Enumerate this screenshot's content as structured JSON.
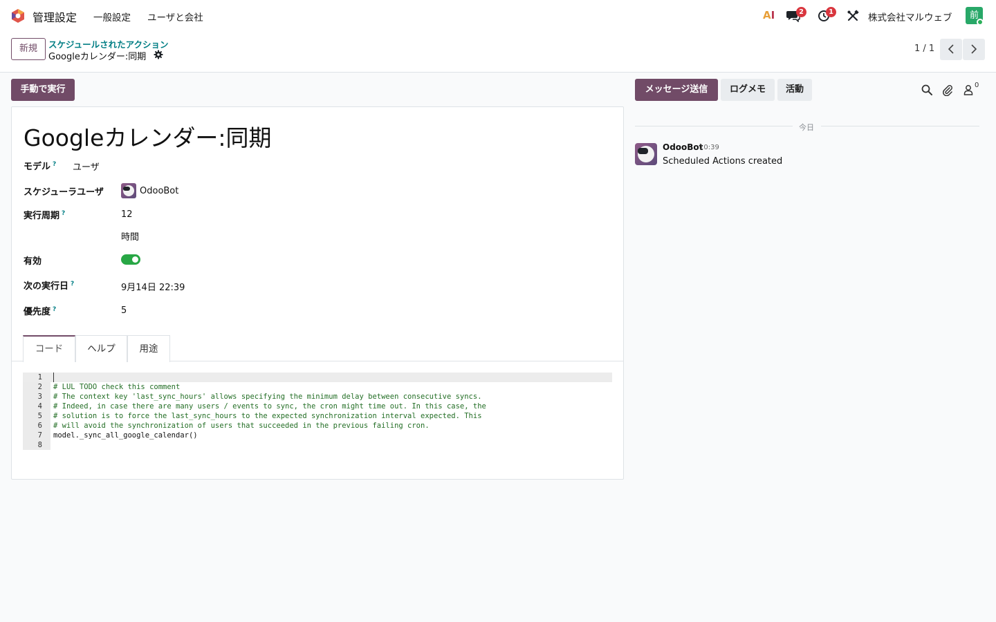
{
  "navbar": {
    "app_name": "管理設定",
    "menu": [
      "一般設定",
      "ユーザと会社"
    ],
    "ai_label_a": "A",
    "ai_label_i": "I",
    "messages_badge": "2",
    "activities_badge": "1",
    "company": "株式会社マルウェブ",
    "user_initial": "前"
  },
  "control": {
    "new_button": "新規",
    "breadcrumb_parent": "スケジュールされたアクション",
    "breadcrumb_current": "Googleカレンダー:同期",
    "pager": "1 / 1"
  },
  "actions": {
    "run_manually": "手動で実行",
    "send_message": "メッセージ送信",
    "log_note": "ログメモ",
    "activities": "活動",
    "followers_count": "0"
  },
  "form": {
    "title": "Googleカレンダー:同期",
    "model_label": "モデル",
    "model_value": "ユーザ",
    "scheduler_user_label": "スケジューラユーザ",
    "scheduler_user_value": "OdooBot",
    "interval_label": "実行周期",
    "interval_number": "12",
    "interval_unit": "時間",
    "active_label": "有効",
    "active": true,
    "nextcall_label": "次の実行日",
    "nextcall_value": "9月14日 22:39",
    "priority_label": "優先度",
    "priority_value": "5",
    "help_mark": "?"
  },
  "tabs": [
    "コード",
    "ヘルプ",
    "用途"
  ],
  "code_lines": [
    "",
    "# LUL TODO check this comment",
    "# The context key 'last_sync_hours' allows specifying the minimum delay between consecutive syncs.",
    "# Indeed, in case there are many users / events to sync, the cron might time out. In this case, the",
    "# solution is to force the last_sync_hours to the expected synchronization interval expected. This",
    "# will avoid the synchronization of users that succeeded in the previous failing cron.",
    "model._sync_all_google_calendar()",
    ""
  ],
  "line_numbers": [
    "1",
    "2",
    "3",
    "4",
    "5",
    "6",
    "7",
    "8"
  ],
  "chatter": {
    "today": "今日",
    "author": "OdooBot",
    "time": "10:39",
    "body": "Scheduled Actions created"
  },
  "colors": {
    "brand": "#714b67",
    "link": "#017e84",
    "toggle_on": "#28a745",
    "badge": "#d9363e",
    "comment": "#236e25"
  }
}
